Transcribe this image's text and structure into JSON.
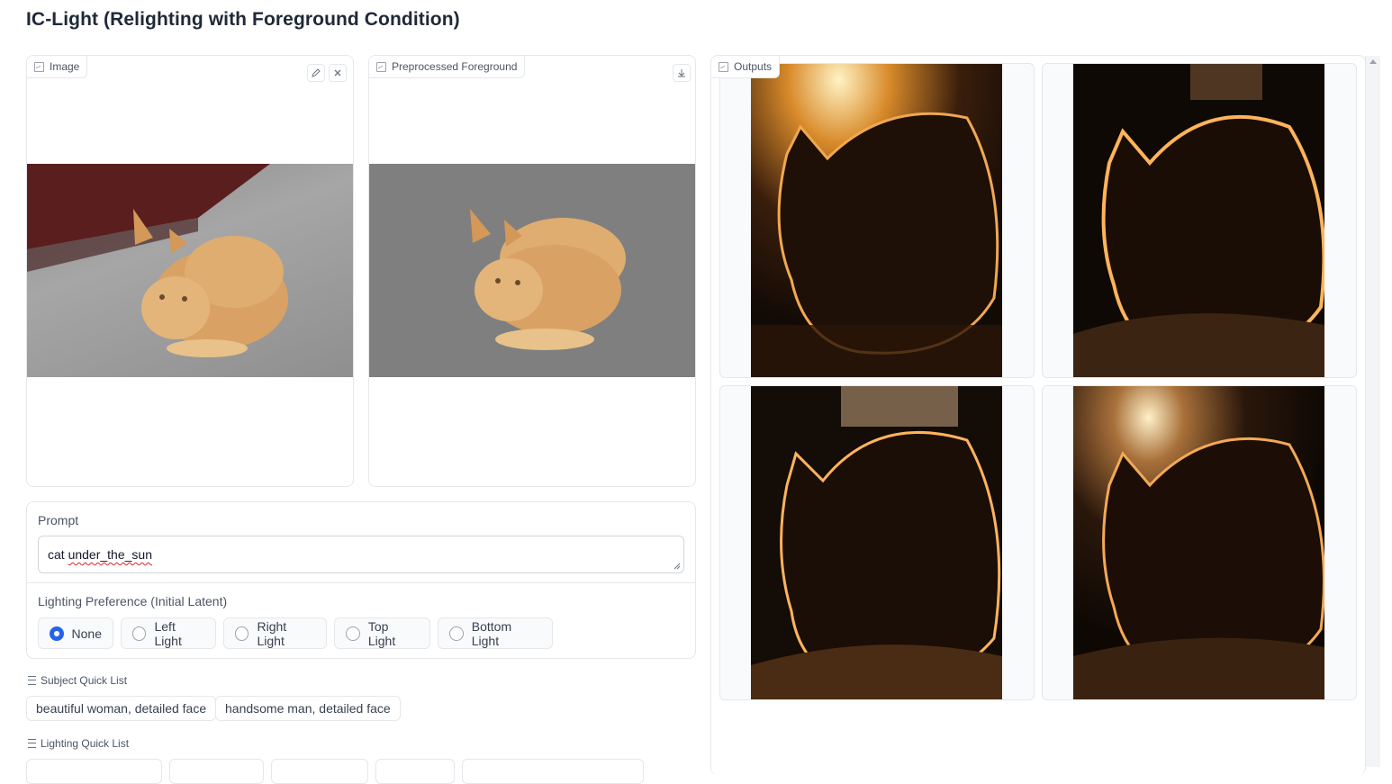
{
  "page_title": "IC-Light (Relighting with Foreground Condition)",
  "image_panel": {
    "label": "Image",
    "icons": [
      "edit-icon",
      "close-icon"
    ]
  },
  "foreground_panel": {
    "label": "Preprocessed Foreground",
    "icons": [
      "download-icon"
    ]
  },
  "outputs_panel": {
    "label": "Outputs",
    "images": [
      "output-1",
      "output-2",
      "output-3",
      "output-4"
    ]
  },
  "prompt": {
    "label": "Prompt",
    "value_prefix": "cat ",
    "value_misspelled": "under_the_sun"
  },
  "lighting": {
    "label": "Lighting Preference (Initial Latent)",
    "options": [
      "None",
      "Left Light",
      "Right Light",
      "Top Light",
      "Bottom Light"
    ],
    "selected": "None"
  },
  "subject_quick_list": {
    "label": "Subject Quick List",
    "items": [
      "beautiful woman, detailed face",
      "handsome man, detailed face"
    ]
  },
  "lighting_quick_list": {
    "label": "Lighting Quick List"
  },
  "colors": {
    "accent": "#2563eb",
    "border": "#e5e7eb"
  }
}
